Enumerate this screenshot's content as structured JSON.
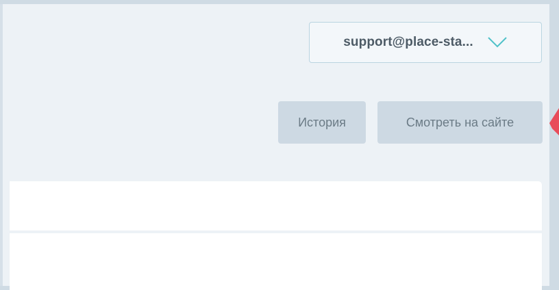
{
  "header": {
    "account_label": "support@place-sta...",
    "account_dropdown_icon": "chevron-down-icon"
  },
  "toolbar": {
    "history_label": "История",
    "view_on_site_label": "Смотреть на сайте"
  },
  "colors": {
    "panel_background": "#edf2f6",
    "button_background": "#cdd9e3",
    "chevron": "#4fc1c8",
    "arrow_annotation": "#e84c5a"
  }
}
